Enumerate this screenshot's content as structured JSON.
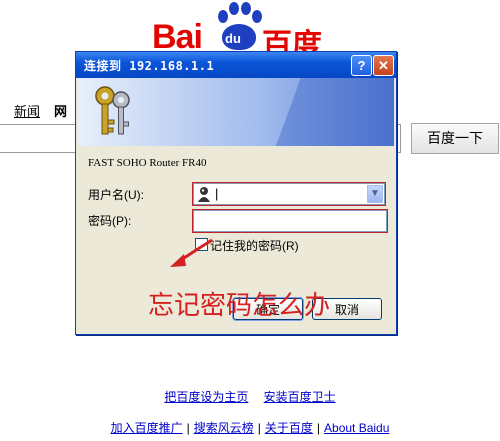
{
  "baidu": {
    "logo_left": "Bai",
    "logo_paw_text": "du",
    "logo_right": "百度",
    "nav": [
      "新闻",
      "网"
    ],
    "search_button": "百度一下",
    "links1": [
      "把百度设为主页",
      "安装百度卫士"
    ],
    "links2": [
      "加入百度推广",
      "搜索风云榜",
      "关于百度",
      "About Baidu"
    ]
  },
  "dialog": {
    "title": "连接到 192.168.1.1",
    "help_label": "?",
    "close_label": "✕",
    "router_name": "FAST SOHO Router FR40",
    "username_label": "用户名(U):",
    "password_label": "密码(P):",
    "username_value": "|",
    "remember_label": "记住我的密码(R)",
    "ok_label": "确定",
    "cancel_label": "取消"
  },
  "annotation": "忘记密码怎么办",
  "colors": {
    "baidu_red": "#e10601",
    "baidu_blue": "#1e3fbf",
    "xp_title": "#0a55d8",
    "annotation": "#d42121"
  }
}
